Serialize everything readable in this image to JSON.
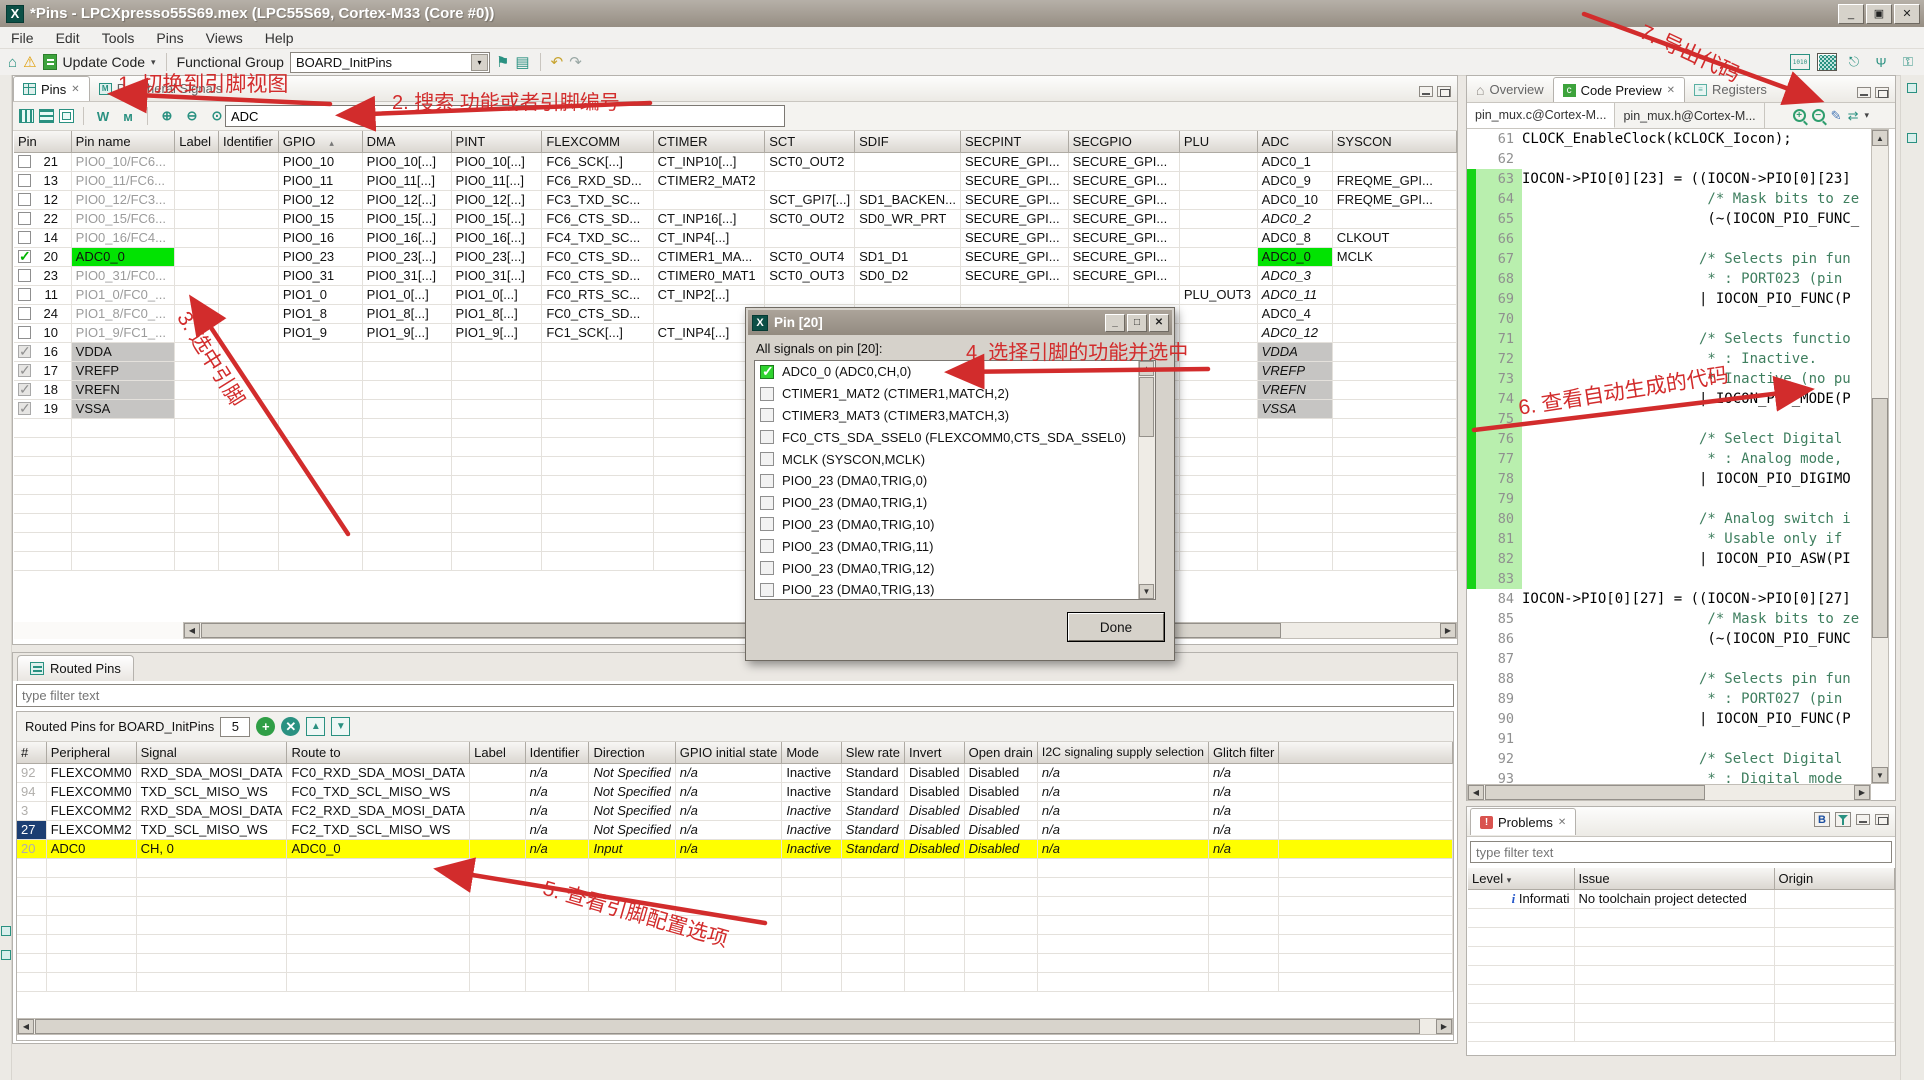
{
  "window": {
    "title": "*Pins - LPCXpresso55S69.mex (LPC55S69, Cortex-M33 (Core #0))"
  },
  "menu": {
    "items": [
      {
        "label": "File"
      },
      {
        "label": "Edit"
      },
      {
        "label": "Tools"
      },
      {
        "label": "Pins"
      },
      {
        "label": "Views"
      },
      {
        "label": "Help"
      }
    ]
  },
  "toolbar": {
    "update_code": "Update Code",
    "functional_group_label": "Functional Group",
    "functional_group_value": "BOARD_InitPins"
  },
  "pins_view": {
    "tab_pins": "Pins",
    "tab_peripheral": "Peripheral Signals",
    "search_value": "ADC",
    "columns": [
      "Pin",
      "Pin name",
      "Label",
      "Identifier",
      "GPIO",
      "DMA",
      "PINT",
      "FLEXCOMM",
      "CTIMER",
      "SCT",
      "SDIF",
      "SECPINT",
      "SECGPIO",
      "PLU",
      "ADC",
      "SYSCON"
    ],
    "sorted_column": "GPIO",
    "rows": [
      {
        "chk": "",
        "pin": "21",
        "name": "PIO0_10/FC6...",
        "nameCls": "dim",
        "gpio": "PIO0_10",
        "dma": "PIO0_10[...]",
        "pint": "PIO0_10[...]",
        "flexcomm": "FC6_SCK[...]",
        "ctimer": "CT_INP10[...]",
        "sct": "SCT0_OUT2",
        "sdif": "",
        "secpint": "SECURE_GPI...",
        "secgpio": "SECURE_GPI...",
        "plu": "",
        "adc": "ADC0_1",
        "adcCls": "",
        "syscon": ""
      },
      {
        "chk": "",
        "pin": "13",
        "name": "PIO0_11/FC6...",
        "nameCls": "dim",
        "gpio": "PIO0_11",
        "dma": "PIO0_11[...]",
        "pint": "PIO0_11[...]",
        "flexcomm": "FC6_RXD_SD...",
        "ctimer": "CTIMER2_MAT2",
        "sct": "",
        "sdif": "",
        "secpint": "SECURE_GPI...",
        "secgpio": "SECURE_GPI...",
        "plu": "",
        "adc": "ADC0_9",
        "adcCls": "",
        "syscon": "FREQME_GPI..."
      },
      {
        "chk": "",
        "pin": "12",
        "name": "PIO0_12/FC3...",
        "nameCls": "dim",
        "gpio": "PIO0_12",
        "dma": "PIO0_12[...]",
        "pint": "PIO0_12[...]",
        "flexcomm": "FC3_TXD_SC...",
        "ctimer": "",
        "sct": "SCT_GPI7[...]",
        "sdif": "SD1_BACKEN...",
        "secpint": "SECURE_GPI...",
        "secgpio": "SECURE_GPI...",
        "plu": "",
        "adc": "ADC0_10",
        "adcCls": "",
        "syscon": "FREQME_GPI..."
      },
      {
        "chk": "",
        "pin": "22",
        "name": "PIO0_15/FC6...",
        "nameCls": "dim",
        "gpio": "PIO0_15",
        "dma": "PIO0_15[...]",
        "pint": "PIO0_15[...]",
        "flexcomm": "FC6_CTS_SD...",
        "ctimer": "CT_INP16[...]",
        "sct": "SCT0_OUT2",
        "sdif": "SD0_WR_PRT",
        "secpint": "SECURE_GPI...",
        "secgpio": "SECURE_GPI...",
        "plu": "",
        "adc": "ADC0_2",
        "adcCls": "it",
        "syscon": ""
      },
      {
        "chk": "",
        "pin": "14",
        "name": "PIO0_16/FC4...",
        "nameCls": "dim",
        "gpio": "PIO0_16",
        "dma": "PIO0_16[...]",
        "pint": "PIO0_16[...]",
        "flexcomm": "FC4_TXD_SC...",
        "ctimer": "CT_INP4[...]",
        "sct": "",
        "sdif": "",
        "secpint": "SECURE_GPI...",
        "secgpio": "SECURE_GPI...",
        "plu": "",
        "adc": "ADC0_8",
        "adcCls": "",
        "syscon": "CLKOUT"
      },
      {
        "chk": "chk-green",
        "pin": "20",
        "name": "ADC0_0",
        "nameCls": "sel",
        "gpio": "PIO0_23",
        "dma": "PIO0_23[...]",
        "pint": "PIO0_23[...]",
        "flexcomm": "FC0_CTS_SD...",
        "ctimer": "CTIMER1_MA...",
        "sct": "SCT0_OUT4",
        "sdif": "SD1_D1",
        "secpint": "SECURE_GPI...",
        "secgpio": "SECURE_GPI...",
        "plu": "",
        "adc": "ADC0_0",
        "adcCls": "sel",
        "syscon": "MCLK"
      },
      {
        "chk": "",
        "pin": "23",
        "name": "PIO0_31/FC0...",
        "nameCls": "dim",
        "gpio": "PIO0_31",
        "dma": "PIO0_31[...]",
        "pint": "PIO0_31[...]",
        "flexcomm": "FC0_CTS_SD...",
        "ctimer": "CTIMER0_MAT1",
        "sct": "SCT0_OUT3",
        "sdif": "SD0_D2",
        "secpint": "SECURE_GPI...",
        "secgpio": "SECURE_GPI...",
        "plu": "",
        "adc": "ADC0_3",
        "adcCls": "it",
        "syscon": ""
      },
      {
        "chk": "",
        "pin": "11",
        "name": "PIO1_0/FC0_...",
        "nameCls": "dim",
        "gpio": "PIO1_0",
        "dma": "PIO1_0[...]",
        "pint": "PIO1_0[...]",
        "flexcomm": "FC0_RTS_SC...",
        "ctimer": "CT_INP2[...]",
        "sct": "",
        "sdif": "",
        "secpint": "",
        "secgpio": "",
        "plu": "PLU_OUT3",
        "adc": "ADC0_11",
        "adcCls": "it",
        "syscon": ""
      },
      {
        "chk": "",
        "pin": "24",
        "name": "PIO1_8/FC0_...",
        "nameCls": "dim",
        "gpio": "PIO1_8",
        "dma": "PIO1_8[...]",
        "pint": "PIO1_8[...]",
        "flexcomm": "FC0_CTS_SD...",
        "ctimer": "",
        "sct": "",
        "sdif": "",
        "secpint": "",
        "secgpio": "",
        "plu": "",
        "adc": "ADC0_4",
        "adcCls": "",
        "syscon": ""
      },
      {
        "chk": "",
        "pin": "10",
        "name": "PIO1_9/FC1_...",
        "nameCls": "dim",
        "gpio": "PIO1_9",
        "dma": "PIO1_9[...]",
        "pint": "PIO1_9[...]",
        "flexcomm": "FC1_SCK[...]",
        "ctimer": "CT_INP4[...]",
        "sct": "",
        "sdif": "",
        "secpint": "",
        "secgpio": "",
        "plu": "",
        "adc": "ADC0_12",
        "adcCls": "it",
        "syscon": ""
      },
      {
        "chk": "chk-gray",
        "pin": "16",
        "name": "VDDA",
        "nameCls": "pwr",
        "gpio": "",
        "dma": "",
        "pint": "",
        "flexcomm": "",
        "ctimer": "",
        "sct": "",
        "sdif": "",
        "secpint": "",
        "secgpio": "",
        "plu": "",
        "adc": "VDDA",
        "adcCls": "pwr it",
        "syscon": ""
      },
      {
        "chk": "chk-gray",
        "pin": "17",
        "name": "VREFP",
        "nameCls": "pwr",
        "gpio": "",
        "dma": "",
        "pint": "",
        "flexcomm": "",
        "ctimer": "",
        "sct": "",
        "sdif": "",
        "secpint": "",
        "secgpio": "",
        "plu": "",
        "adc": "VREFP",
        "adcCls": "pwr it",
        "syscon": ""
      },
      {
        "chk": "chk-gray",
        "pin": "18",
        "name": "VREFN",
        "nameCls": "pwr",
        "gpio": "",
        "dma": "",
        "pint": "",
        "flexcomm": "",
        "ctimer": "",
        "sct": "",
        "sdif": "",
        "secpint": "",
        "secgpio": "",
        "plu": "",
        "adc": "VREFN",
        "adcCls": "pwr it",
        "syscon": ""
      },
      {
        "chk": "chk-gray",
        "pin": "19",
        "name": "VSSA",
        "nameCls": "pwr",
        "gpio": "",
        "dma": "",
        "pint": "",
        "flexcomm": "",
        "ctimer": "",
        "sct": "",
        "sdif": "",
        "secpint": "",
        "secgpio": "",
        "plu": "",
        "adc": "VSSA",
        "adcCls": "pwr it",
        "syscon": ""
      }
    ]
  },
  "dialog": {
    "title": "Pin [20]",
    "label": "All signals on pin [20]:",
    "done": "Done",
    "signals": [
      {
        "chk": "on",
        "label": "ADC0_0 (ADC0,CH,0)"
      },
      {
        "chk": "",
        "label": "CTIMER1_MAT2 (CTIMER1,MATCH,2)"
      },
      {
        "chk": "",
        "label": "CTIMER3_MAT3 (CTIMER3,MATCH,3)"
      },
      {
        "chk": "",
        "label": "FC0_CTS_SDA_SSEL0 (FLEXCOMM0,CTS_SDA_SSEL0)"
      },
      {
        "chk": "",
        "label": "MCLK (SYSCON,MCLK)"
      },
      {
        "chk": "",
        "label": "PIO0_23 (DMA0,TRIG,0)"
      },
      {
        "chk": "",
        "label": "PIO0_23 (DMA0,TRIG,1)"
      },
      {
        "chk": "",
        "label": "PIO0_23 (DMA0,TRIG,10)"
      },
      {
        "chk": "",
        "label": "PIO0_23 (DMA0,TRIG,11)"
      },
      {
        "chk": "",
        "label": "PIO0_23 (DMA0,TRIG,12)"
      },
      {
        "chk": "",
        "label": "PIO0_23 (DMA0,TRIG,13)"
      }
    ]
  },
  "routed": {
    "tab": "Routed Pins",
    "filter_placeholder": "type filter text",
    "toolbar_label": "Routed Pins for BOARD_InitPins",
    "count": "5",
    "columns": [
      "#",
      "Peripheral",
      "Signal",
      "Route to",
      "Label",
      "Identifier",
      "Direction",
      "GPIO initial state",
      "Mode",
      "Slew rate",
      "Invert",
      "Open drain",
      "I2C signaling supply selection",
      "Glitch filter"
    ],
    "rows": [
      {
        "num": "92",
        "numCls": "",
        "periph": "FLEXCOMM0",
        "signal": "RXD_SDA_MOSI_DATA",
        "route": "FC0_RXD_SDA_MOSI_DATA",
        "label": "",
        "ident": "n/a",
        "dir": "Not Specified",
        "gpio_init": "n/a",
        "mode": "Inactive",
        "slew": "Standard",
        "invert": "Disabled",
        "open": "Disabled",
        "i2c": "n/a",
        "glitch": "n/a",
        "rowCls": "",
        "valCls": ""
      },
      {
        "num": "94",
        "numCls": "",
        "periph": "FLEXCOMM0",
        "signal": "TXD_SCL_MISO_WS",
        "route": "FC0_TXD_SCL_MISO_WS",
        "label": "",
        "ident": "n/a",
        "dir": "Not Specified",
        "gpio_init": "n/a",
        "mode": "Inactive",
        "slew": "Standard",
        "invert": "Disabled",
        "open": "Disabled",
        "i2c": "n/a",
        "glitch": "n/a",
        "rowCls": "",
        "valCls": ""
      },
      {
        "num": "3",
        "numCls": "",
        "periph": "FLEXCOMM2",
        "signal": "RXD_SDA_MOSI_DATA",
        "route": "FC2_RXD_SDA_MOSI_DATA",
        "label": "",
        "ident": "n/a",
        "dir": "Not Specified",
        "gpio_init": "n/a",
        "mode": "Inactive",
        "slew": "Standard",
        "invert": "Disabled",
        "open": "Disabled",
        "i2c": "n/a",
        "glitch": "n/a",
        "rowCls": "",
        "valCls": "it"
      },
      {
        "num": "27",
        "numCls": "sel-num",
        "periph": "FLEXCOMM2",
        "signal": "TXD_SCL_MISO_WS",
        "route": "FC2_TXD_SCL_MISO_WS",
        "label": "",
        "ident": "n/a",
        "dir": "Not Specified",
        "gpio_init": "n/a",
        "mode": "Inactive",
        "slew": "Standard",
        "invert": "Disabled",
        "open": "Disabled",
        "i2c": "n/a",
        "glitch": "n/a",
        "rowCls": "",
        "valCls": "it"
      },
      {
        "num": "20",
        "numCls": "",
        "periph": "ADC0",
        "signal": "CH, 0",
        "route": "ADC0_0",
        "label": "",
        "ident": "n/a",
        "dir": "Input",
        "gpio_init": "n/a",
        "mode": "Inactive",
        "slew": "Standard",
        "invert": "Disabled",
        "open": "Disabled",
        "i2c": "n/a",
        "glitch": "n/a",
        "rowCls": "yellow",
        "valCls": "it"
      }
    ]
  },
  "code_panel": {
    "tab_overview": "Overview",
    "tab_code_preview": "Code Preview",
    "tab_registers": "Registers",
    "file_tab_c": "pin_mux.c@Cortex-M...",
    "file_tab_h": "pin_mux.h@Cortex-M...",
    "lines": [
      {
        "n": "61",
        "t": "CLOCK_EnableClock(kCLOCK_Iocon);",
        "cls": ""
      },
      {
        "n": "62",
        "t": "",
        "cls": ""
      },
      {
        "n": "63",
        "t": "IOCON->PIO[0][23] = ((IOCON->PIO[0][23]",
        "cls": "hl"
      },
      {
        "n": "64",
        "t": "                      /* Mask bits to ze",
        "cls": "hl cmt"
      },
      {
        "n": "65",
        "t": "                      (~(IOCON_PIO_FUNC_",
        "cls": "hl"
      },
      {
        "n": "66",
        "t": "",
        "cls": "hl"
      },
      {
        "n": "67",
        "t": "                     /* Selects pin fun",
        "cls": "hl cmt"
      },
      {
        "n": "68",
        "t": "                      * : PORT023 (pin ",
        "cls": "hl cmt"
      },
      {
        "n": "69",
        "t": "                     | IOCON_PIO_FUNC(P",
        "cls": "hl"
      },
      {
        "n": "70",
        "t": "",
        "cls": "hl"
      },
      {
        "n": "71",
        "t": "                     /* Selects functio",
        "cls": "hl cmt"
      },
      {
        "n": "72",
        "t": "                      * : Inactive.",
        "cls": "hl cmt"
      },
      {
        "n": "73",
        "t": "                      * Inactive (no pu",
        "cls": "hl cmt"
      },
      {
        "n": "74",
        "t": "                     | IOCON_PIO_MODE(P",
        "cls": "hl"
      },
      {
        "n": "75",
        "t": "",
        "cls": "hl"
      },
      {
        "n": "76",
        "t": "                     /* Select Digital ",
        "cls": "hl cmt"
      },
      {
        "n": "77",
        "t": "                      * : Analog mode, ",
        "cls": "hl cmt"
      },
      {
        "n": "78",
        "t": "                     | IOCON_PIO_DIGIMO",
        "cls": "hl"
      },
      {
        "n": "79",
        "t": "",
        "cls": "hl"
      },
      {
        "n": "80",
        "t": "                     /* Analog switch i",
        "cls": "hl cmt"
      },
      {
        "n": "81",
        "t": "                      * Usable only if ",
        "cls": "hl cmt"
      },
      {
        "n": "82",
        "t": "                     | IOCON_PIO_ASW(PI",
        "cls": "hl"
      },
      {
        "n": "83",
        "t": "",
        "cls": "hl"
      },
      {
        "n": "84",
        "t": "IOCON->PIO[0][27] = ((IOCON->PIO[0][27]",
        "cls": ""
      },
      {
        "n": "85",
        "t": "                      /* Mask bits to ze",
        "cls": "cmt"
      },
      {
        "n": "86",
        "t": "                      (~(IOCON_PIO_FUNC",
        "cls": ""
      },
      {
        "n": "87",
        "t": "",
        "cls": ""
      },
      {
        "n": "88",
        "t": "                     /* Selects pin fun",
        "cls": "cmt"
      },
      {
        "n": "89",
        "t": "                      * : PORT027 (pin ",
        "cls": "cmt"
      },
      {
        "n": "90",
        "t": "                     | IOCON_PIO_FUNC(P",
        "cls": ""
      },
      {
        "n": "91",
        "t": "",
        "cls": ""
      },
      {
        "n": "92",
        "t": "                     /* Select Digital ",
        "cls": "cmt"
      },
      {
        "n": "93",
        "t": "                      * : Digital mode",
        "cls": "cmt"
      }
    ]
  },
  "problems": {
    "tab": "Problems",
    "filter_placeholder": "type filter text",
    "columns": [
      "Level",
      "Issue",
      "Origin"
    ],
    "rows": [
      {
        "level": "Informati",
        "issue": "No toolchain project detected",
        "origin": ""
      }
    ]
  },
  "annotations": {
    "a1": "1. 切换到引脚视图",
    "a2": "2. 搜索 功能或者引脚编号",
    "a3": "3. 选中引脚",
    "a4": "4. 选择引脚的功能并选中",
    "a5": "5. 查看引脚配置选项",
    "a6": "6. 查看自动生成的代码",
    "a7": "7. 导出代码"
  },
  "colors": {
    "accent_teal": "#2a9181",
    "selection_green": "#02e302",
    "highlight_yellow": "#ffff00",
    "annotation_red": "#d22c2c",
    "code_highlight_bar": "#17d417"
  }
}
